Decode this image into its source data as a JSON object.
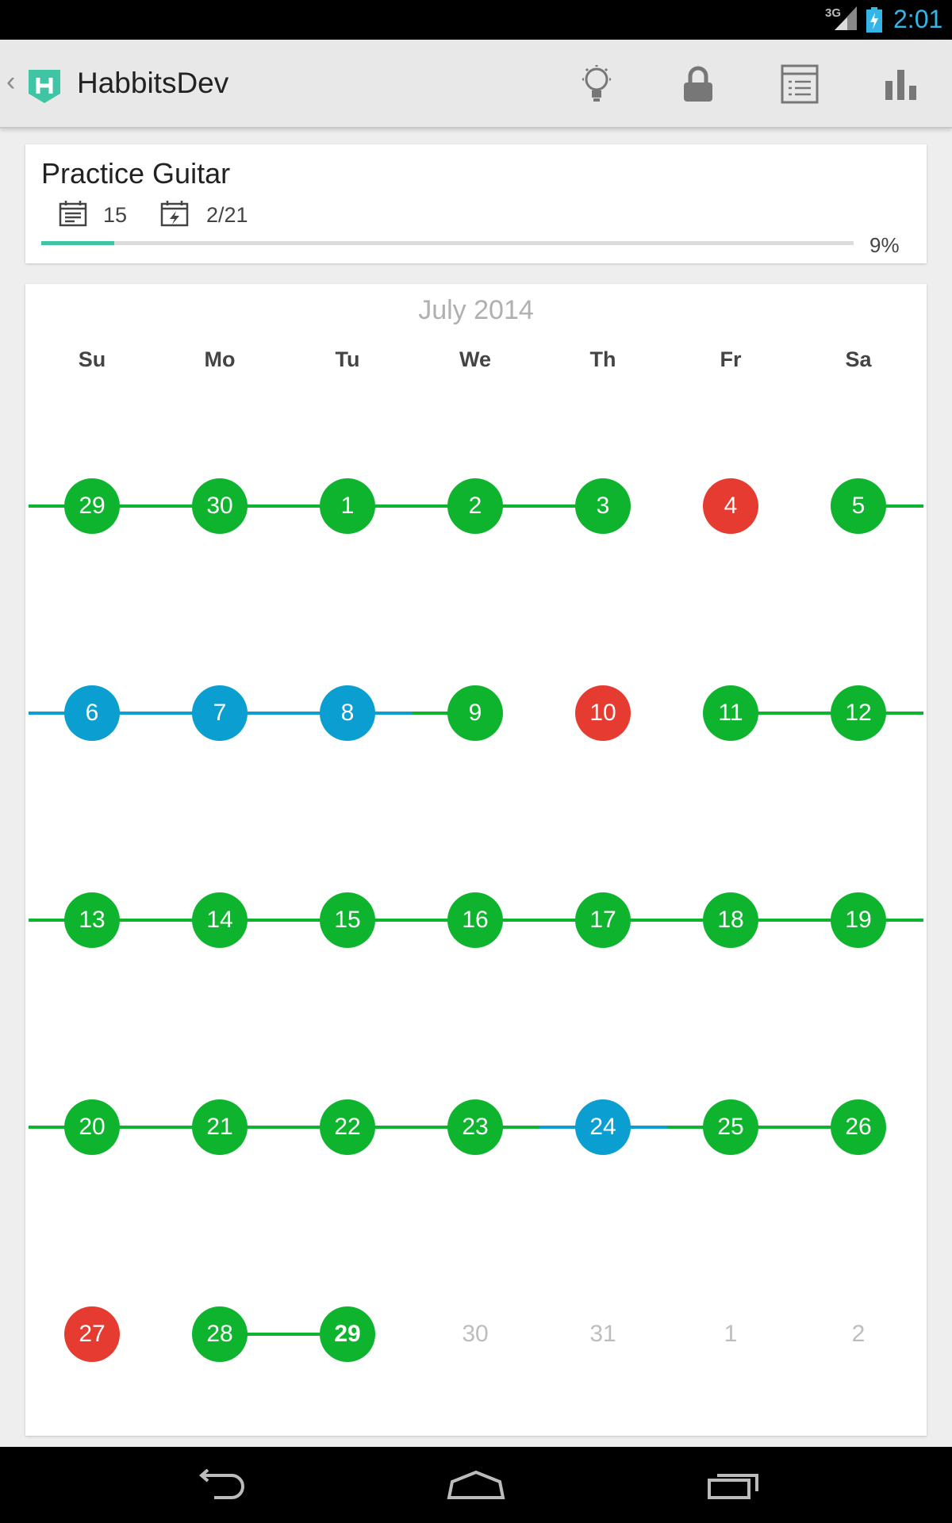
{
  "status_bar": {
    "network": "3G",
    "time": "2:01"
  },
  "action_bar": {
    "title": "HabbitsDev",
    "icons": [
      "lightbulb-icon",
      "lock-icon",
      "list-icon",
      "bar-chart-icon"
    ]
  },
  "habit": {
    "name": "Practice Guitar",
    "count": "15",
    "date": "2/21",
    "progress": 0.09,
    "progress_label": "9%"
  },
  "calendar": {
    "month_title": "July 2014",
    "weekdays": [
      "Su",
      "Mo",
      "Tu",
      "We",
      "Th",
      "Fr",
      "Sa"
    ],
    "weeks": [
      [
        {
          "label": "29",
          "status": "done"
        },
        {
          "label": "30",
          "status": "done"
        },
        {
          "label": "1",
          "status": "done"
        },
        {
          "label": "2",
          "status": "done"
        },
        {
          "label": "3",
          "status": "done"
        },
        {
          "label": "4",
          "status": "missed"
        },
        {
          "label": "5",
          "status": "done"
        }
      ],
      [
        {
          "label": "6",
          "status": "skipped"
        },
        {
          "label": "7",
          "status": "skipped"
        },
        {
          "label": "8",
          "status": "skipped"
        },
        {
          "label": "9",
          "status": "done"
        },
        {
          "label": "10",
          "status": "missed"
        },
        {
          "label": "11",
          "status": "done"
        },
        {
          "label": "12",
          "status": "done"
        }
      ],
      [
        {
          "label": "13",
          "status": "done"
        },
        {
          "label": "14",
          "status": "done"
        },
        {
          "label": "15",
          "status": "done"
        },
        {
          "label": "16",
          "status": "done"
        },
        {
          "label": "17",
          "status": "done"
        },
        {
          "label": "18",
          "status": "done"
        },
        {
          "label": "19",
          "status": "done"
        }
      ],
      [
        {
          "label": "20",
          "status": "done"
        },
        {
          "label": "21",
          "status": "done"
        },
        {
          "label": "22",
          "status": "done"
        },
        {
          "label": "23",
          "status": "done"
        },
        {
          "label": "24",
          "status": "skipped"
        },
        {
          "label": "25",
          "status": "done"
        },
        {
          "label": "26",
          "status": "done"
        }
      ],
      [
        {
          "label": "27",
          "status": "missed"
        },
        {
          "label": "28",
          "status": "done"
        },
        {
          "label": "29",
          "status": "done",
          "today": true
        },
        {
          "label": "30",
          "status": "future"
        },
        {
          "label": "31",
          "status": "future"
        },
        {
          "label": "1",
          "status": "future"
        },
        {
          "label": "2",
          "status": "future"
        }
      ]
    ]
  },
  "colors": {
    "done": "#0fb42e",
    "skipped": "#0a9fd0",
    "missed": "#e53b30",
    "future_text": "#bdbdbd",
    "progress": "#3fc5a4",
    "accent_clock": "#33b5e5"
  },
  "nav_bar": {
    "buttons": [
      "back-icon",
      "home-icon",
      "recents-icon"
    ]
  }
}
